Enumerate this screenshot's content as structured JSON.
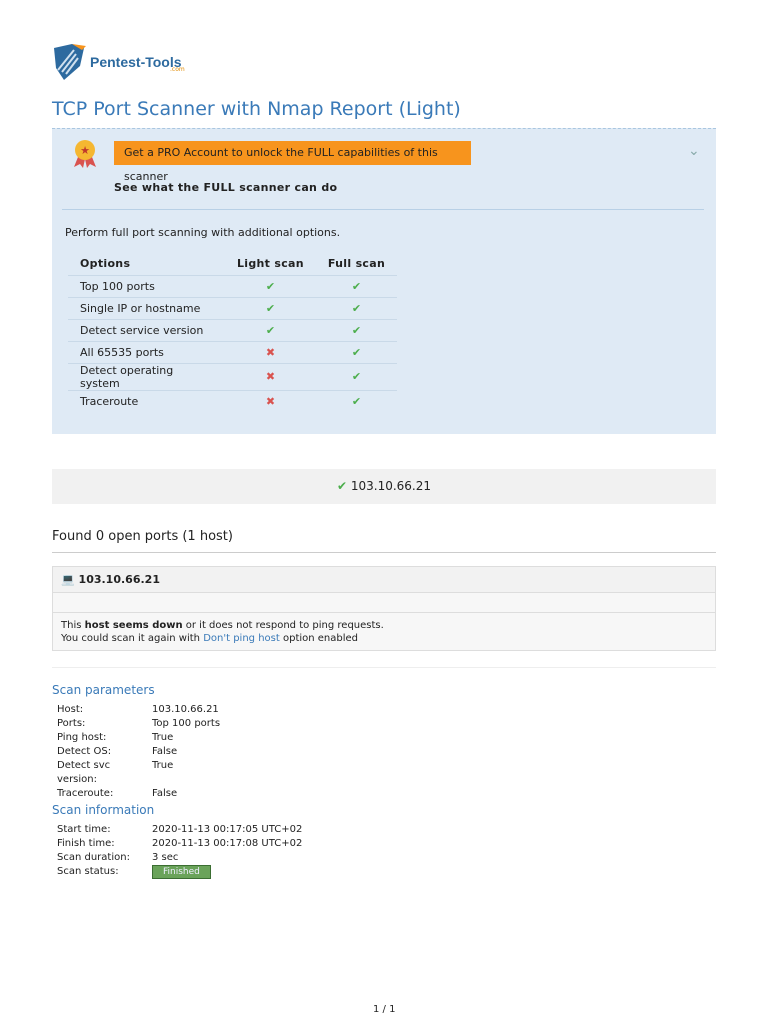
{
  "logo": {
    "name": "Pentest-Tools",
    "suffix": ".com"
  },
  "title": "TCP Port Scanner with Nmap Report (Light)",
  "promo": {
    "button": "Get a PRO Account to unlock the FULL capabilities of this scanner",
    "see": "See what the FULL scanner can do",
    "description": "Perform full port scanning with additional options.",
    "headers": [
      "Options",
      "Light scan",
      "Full scan"
    ],
    "rows": [
      {
        "option": "Top 100 ports",
        "light": true,
        "full": true
      },
      {
        "option": "Single IP or hostname",
        "light": true,
        "full": true
      },
      {
        "option": "Detect service version",
        "light": true,
        "full": true
      },
      {
        "option": "All 65535 ports",
        "light": false,
        "full": true
      },
      {
        "option": "Detect operating system",
        "light": false,
        "full": true
      },
      {
        "option": "Traceroute",
        "light": false,
        "full": true
      }
    ]
  },
  "target": "103.10.66.21",
  "found": "Found 0 open ports (1 host)",
  "host": {
    "ip": "103.10.66.21",
    "msg1a": "This ",
    "msg1b": "host seems down",
    "msg1c": " or it does not respond to ping requests.",
    "msg2a": "You could scan it again with ",
    "link": "Don't ping host",
    "msg2c": " option enabled"
  },
  "params": {
    "title": "Scan parameters",
    "items": [
      [
        "Host:",
        "103.10.66.21"
      ],
      [
        "Ports:",
        "Top 100 ports"
      ],
      [
        "Ping host:",
        "True"
      ],
      [
        "Detect OS:",
        "False"
      ],
      [
        "Detect svc version:",
        "True"
      ],
      [
        "Traceroute:",
        "False"
      ]
    ]
  },
  "info": {
    "title": "Scan information",
    "items": [
      [
        "Start time:",
        "2020-11-13 00:17:05 UTC+02"
      ],
      [
        "Finish time:",
        "2020-11-13 00:17:08 UTC+02"
      ],
      [
        "Scan duration:",
        "3 sec"
      ]
    ],
    "status_label": "Scan status:",
    "status": "Finished"
  },
  "page": "1 / 1"
}
